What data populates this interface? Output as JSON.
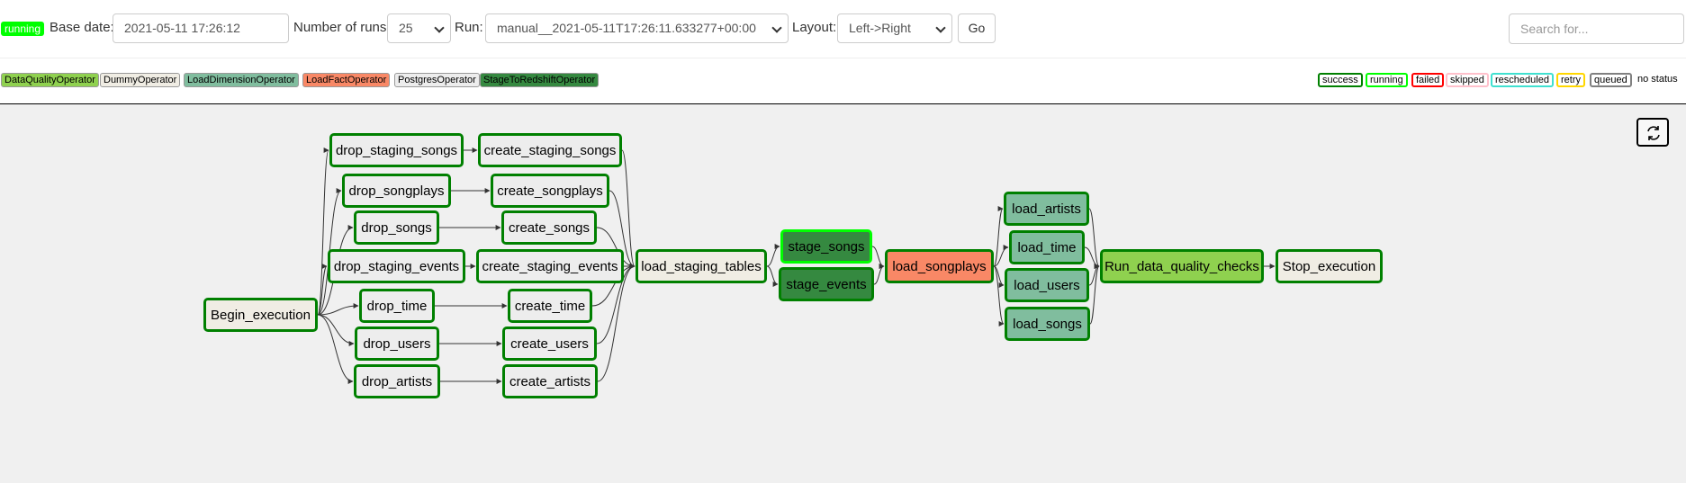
{
  "toolbar": {
    "dag_state": "running",
    "base_date_label": "Base date:",
    "base_date_value": "2021-05-11 17:26:12",
    "num_runs_label": "Number of runs:",
    "num_runs_value": "25",
    "run_label": "Run:",
    "run_value": "manual__2021-05-11T17:26:11.633277+00:00",
    "layout_label": "Layout:",
    "layout_value": "Left->Right",
    "go_label": "Go",
    "search_placeholder": "Search for..."
  },
  "operator_legend": [
    {
      "label": "DataQualityOperator",
      "color": "#8fd14f"
    },
    {
      "label": "DummyOperator",
      "color": "#f0ede4"
    },
    {
      "label": "LoadDimensionOperator",
      "color": "#80bd9e"
    },
    {
      "label": "LoadFactOperator",
      "color": "#f98866"
    },
    {
      "label": "PostgresOperator",
      "color": "#ededed"
    },
    {
      "label": "StageToRedshiftOperator",
      "color": "#358940"
    }
  ],
  "status_legend": [
    {
      "label": "success",
      "color": "#008000"
    },
    {
      "label": "running",
      "color": "#00ff00"
    },
    {
      "label": "failed",
      "color": "#ff0000"
    },
    {
      "label": "skipped",
      "color": "#ffc0cb"
    },
    {
      "label": "rescheduled",
      "color": "#40e0d0"
    },
    {
      "label": "retry",
      "color": "#ffd700"
    },
    {
      "label": "queued",
      "color": "#808080"
    }
  ],
  "no_status_label": "no status",
  "graph": {
    "refresh_icon": "refresh-icon",
    "tasks": {
      "begin": {
        "label": "Begin_execution",
        "color": "#f0ede4",
        "state": "success"
      },
      "drop_staging_songs": {
        "label": "drop_staging_songs",
        "color": "#ededed",
        "state": "success"
      },
      "drop_songplays": {
        "label": "drop_songplays",
        "color": "#ededed",
        "state": "success"
      },
      "drop_songs": {
        "label": "drop_songs",
        "color": "#ededed",
        "state": "success"
      },
      "drop_staging_events": {
        "label": "drop_staging_events",
        "color": "#ededed",
        "state": "success"
      },
      "drop_time": {
        "label": "drop_time",
        "color": "#ededed",
        "state": "success"
      },
      "drop_users": {
        "label": "drop_users",
        "color": "#ededed",
        "state": "success"
      },
      "drop_artists": {
        "label": "drop_artists",
        "color": "#ededed",
        "state": "success"
      },
      "create_staging_songs": {
        "label": "create_staging_songs",
        "color": "#ededed",
        "state": "success"
      },
      "create_songplays": {
        "label": "create_songplays",
        "color": "#ededed",
        "state": "success"
      },
      "create_songs": {
        "label": "create_songs",
        "color": "#ededed",
        "state": "success"
      },
      "create_staging_events": {
        "label": "create_staging_events",
        "color": "#ededed",
        "state": "success"
      },
      "create_time": {
        "label": "create_time",
        "color": "#ededed",
        "state": "success"
      },
      "create_users": {
        "label": "create_users",
        "color": "#ededed",
        "state": "success"
      },
      "create_artists": {
        "label": "create_artists",
        "color": "#ededed",
        "state": "success"
      },
      "load_staging_tables": {
        "label": "load_staging_tables",
        "color": "#f0ede4",
        "state": "success"
      },
      "stage_songs": {
        "label": "stage_songs",
        "color": "#358940",
        "state": "running"
      },
      "stage_events": {
        "label": "stage_events",
        "color": "#358940",
        "state": "success"
      },
      "load_songplays": {
        "label": "load_songplays",
        "color": "#f98866",
        "state": "success"
      },
      "load_artists": {
        "label": "load_artists",
        "color": "#80bd9e",
        "state": "success"
      },
      "load_time": {
        "label": "load_time",
        "color": "#80bd9e",
        "state": "success"
      },
      "load_users": {
        "label": "load_users",
        "color": "#80bd9e",
        "state": "success"
      },
      "load_songs": {
        "label": "load_songs",
        "color": "#80bd9e",
        "state": "success"
      },
      "quality": {
        "label": "Run_data_quality_checks",
        "color": "#8fd14f",
        "state": "success"
      },
      "stop": {
        "label": "Stop_execution",
        "color": "#f0ede4",
        "state": "success"
      }
    },
    "edges": [
      [
        "begin",
        "drop_staging_songs"
      ],
      [
        "begin",
        "drop_songplays"
      ],
      [
        "begin",
        "drop_songs"
      ],
      [
        "begin",
        "drop_staging_events"
      ],
      [
        "begin",
        "drop_time"
      ],
      [
        "begin",
        "drop_users"
      ],
      [
        "begin",
        "drop_artists"
      ],
      [
        "drop_staging_songs",
        "create_staging_songs"
      ],
      [
        "drop_songplays",
        "create_songplays"
      ],
      [
        "drop_songs",
        "create_songs"
      ],
      [
        "drop_staging_events",
        "create_staging_events"
      ],
      [
        "drop_time",
        "create_time"
      ],
      [
        "drop_users",
        "create_users"
      ],
      [
        "drop_artists",
        "create_artists"
      ],
      [
        "create_staging_songs",
        "load_staging_tables"
      ],
      [
        "create_songplays",
        "load_staging_tables"
      ],
      [
        "create_songs",
        "load_staging_tables"
      ],
      [
        "create_staging_events",
        "load_staging_tables"
      ],
      [
        "create_time",
        "load_staging_tables"
      ],
      [
        "create_users",
        "load_staging_tables"
      ],
      [
        "create_artists",
        "load_staging_tables"
      ],
      [
        "load_staging_tables",
        "stage_songs"
      ],
      [
        "load_staging_tables",
        "stage_events"
      ],
      [
        "stage_songs",
        "load_songplays"
      ],
      [
        "stage_events",
        "load_songplays"
      ],
      [
        "load_songplays",
        "load_artists"
      ],
      [
        "load_songplays",
        "load_time"
      ],
      [
        "load_songplays",
        "load_users"
      ],
      [
        "load_songplays",
        "load_songs"
      ],
      [
        "load_artists",
        "quality"
      ],
      [
        "load_time",
        "quality"
      ],
      [
        "load_users",
        "quality"
      ],
      [
        "load_songs",
        "quality"
      ],
      [
        "quality",
        "stop"
      ]
    ]
  }
}
